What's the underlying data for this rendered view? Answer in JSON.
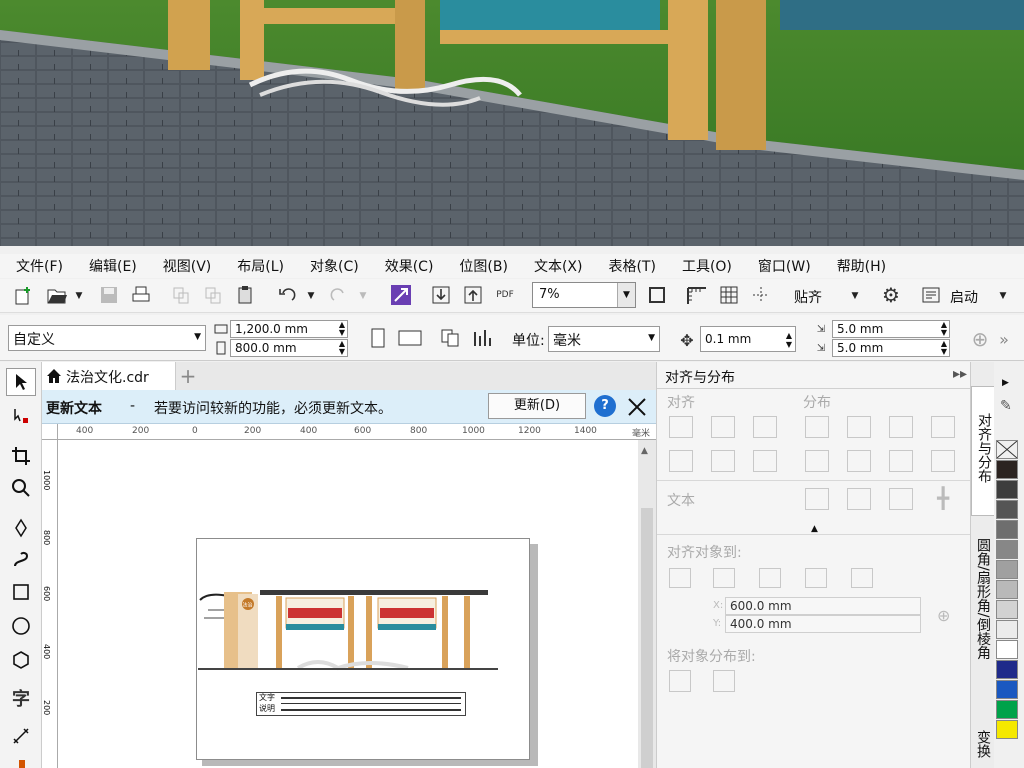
{
  "menu": [
    "文件(F)",
    "编辑(E)",
    "视图(V)",
    "布局(L)",
    "对象(C)",
    "效果(C)",
    "位图(B)",
    "文本(X)",
    "表格(T)",
    "工具(O)",
    "窗口(W)",
    "帮助(H)"
  ],
  "toolbar1": {
    "zoom": "7%",
    "snap_label": "贴齐",
    "launch_label": "启动",
    "pdf_label": "PDF"
  },
  "toolbar2": {
    "preset": "自定义",
    "width": "1,200.0 mm",
    "height": "800.0 mm",
    "unit_label": "单位:",
    "unit_value": "毫米",
    "nudge": "0.1 mm",
    "dup_x": "5.0 mm",
    "dup_y": "5.0 mm"
  },
  "document": {
    "tab_name": "法治文化.cdr",
    "add_tab": "+"
  },
  "infobar": {
    "title": "更新文本",
    "separator": "-",
    "message": "若要访问较新的功能，必须更新文本。",
    "update_button": "更新(D)",
    "help": "?"
  },
  "ruler": {
    "ticks": [
      "400",
      "200",
      "0",
      "200",
      "400",
      "600",
      "800",
      "1000",
      "1200",
      "1400"
    ],
    "unit": "毫米",
    "vticks": [
      "1000",
      "800",
      "600",
      "400",
      "200"
    ]
  },
  "docker": {
    "title": "对齐与分布",
    "align_label": "对齐",
    "distribute_label": "分布",
    "text_label": "文本",
    "align_to_label": "对齐对象到:",
    "x_label": "X:",
    "x_value": "600.0 mm",
    "y_label": "Y:",
    "y_value": "400.0 mm",
    "distribute_to_label": "将对象分布到:"
  },
  "side_tabs": [
    "对齐与分布",
    "圆角/扇形角/倒棱角",
    "变换"
  ],
  "drawing": {
    "caption_label_line1": "文字",
    "caption_label_line2": "说明",
    "badge_text": "法治"
  },
  "palette": [
    "#ffffff",
    "#2b2320",
    "#3d3d3d",
    "#555555",
    "#6e6e6e",
    "#878787",
    "#a0a0a0",
    "#b9b9b9",
    "#d2d2d2",
    "#ebebeb",
    "#ffffff",
    "#1f2a8a",
    "#1a58c0",
    "#00a24a",
    "#f5e800"
  ],
  "colors": {
    "accent": "#2b7bd6",
    "frame_wood": "#d9a25a",
    "info_bg": "#dceef9"
  }
}
